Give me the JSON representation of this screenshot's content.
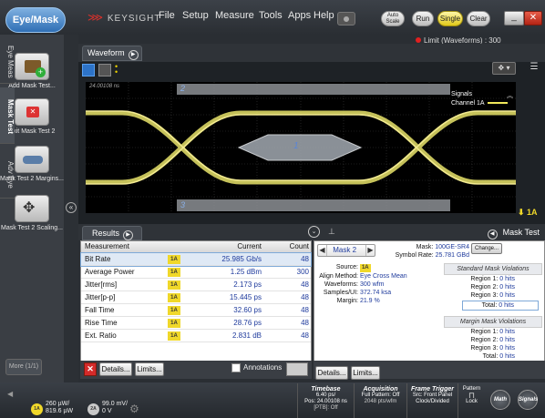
{
  "app": {
    "mode_button": "Eye/Mask",
    "brand": "KEYSIGHT",
    "menu": [
      "File",
      "Setup",
      "Measure",
      "Tools",
      "Apps",
      "Help"
    ],
    "auto_scale": "Auto Scale",
    "run": "Run",
    "single": "Single",
    "clear": "Clear",
    "limit_status": "Limit (Waveforms) : 300"
  },
  "left_panel": {
    "items": [
      {
        "label": "Add Mask Test...",
        "icon": "add-mask-icon"
      },
      {
        "label": "Exit Mask Test 2",
        "icon": "exit-mask-icon"
      },
      {
        "label": "Mask Test 2 Margins...",
        "icon": "margins-icon"
      },
      {
        "label": "Mask Test 2 Scaling...",
        "icon": "scaling-icon"
      }
    ],
    "more": "More (1/1)"
  },
  "vertical_tabs": [
    "Eye Meas",
    "Mask Test",
    "Adv Eye"
  ],
  "waveform": {
    "tab_label": "Waveform",
    "timestamp": "24.00108 ns",
    "region_labels": [
      "1",
      "2",
      "3"
    ],
    "legend_title": "Signals",
    "legend_channel": "Channel 1A",
    "channel_marker": "1A"
  },
  "results": {
    "tab_label": "Results",
    "columns": [
      "Measurement",
      "Current",
      "Count"
    ],
    "rows": [
      {
        "name": "Bit Rate",
        "ch": "1A",
        "current": "25.985 Gb/s",
        "count": "48"
      },
      {
        "name": "Average Power",
        "ch": "1A",
        "current": "1.25 dBm",
        "count": "300"
      },
      {
        "name": "Jitter[rms]",
        "ch": "1A",
        "current": "2.173 ps",
        "count": "48"
      },
      {
        "name": "Jitter[p-p]",
        "ch": "1A",
        "current": "15.445 ps",
        "count": "48"
      },
      {
        "name": "Fall Time",
        "ch": "1A",
        "current": "32.60 ps",
        "count": "48"
      },
      {
        "name": "Rise Time",
        "ch": "1A",
        "current": "28.76 ps",
        "count": "48"
      },
      {
        "name": "Ext. Ratio",
        "ch": "1A",
        "current": "2.831 dB",
        "count": "48"
      }
    ],
    "details": "Details...",
    "limits": "Limits...",
    "annotations": "Annotations"
  },
  "mask_panel": {
    "tab_label": "Mask Test",
    "selector": "Mask 2",
    "mask_label": "Mask:",
    "mask_value": "100GE-SR4",
    "change": "Change...",
    "symbol_rate_label": "Symbol Rate:",
    "symbol_rate": "25.781 GBd",
    "source_label": "Source:",
    "source": "1A",
    "align_label": "Align Method:",
    "align": "Eye Cross Mean",
    "waveforms_label": "Waveforms:",
    "waveforms": "300 wfm",
    "samples_label": "Samples/UI:",
    "samples": "372.74 ksa",
    "margin_label": "Margin:",
    "margin": "21.9 %",
    "standard_title": "Standard Mask Violations",
    "standard": [
      {
        "label": "Region 1:",
        "value": "0 hits"
      },
      {
        "label": "Region 2:",
        "value": "0 hits"
      },
      {
        "label": "Region 3:",
        "value": "0 hits"
      },
      {
        "label": "Total:",
        "value": "0 hits"
      }
    ],
    "margin_title": "Margin Mask Violations",
    "margin_v": [
      {
        "label": "Region 1:",
        "value": "0 hits"
      },
      {
        "label": "Region 2:",
        "value": "0 hits"
      },
      {
        "label": "Region 3:",
        "value": "0 hits"
      },
      {
        "label": "Total:",
        "value": "0 hits"
      }
    ],
    "details": "Details...",
    "limits": "Limits..."
  },
  "bottom": {
    "ch1": {
      "badge": "1A",
      "line1": "260 µW/",
      "line2": "819.6 µW"
    },
    "ch2": {
      "badge": "2A",
      "line1": "99.0 mV/",
      "line2": "0 V"
    },
    "timebase": {
      "title": "Timebase",
      "l1": "6.40 ps/",
      "l2": "Pos: 24.00108 ns",
      "l3": "[PTB]: Off"
    },
    "acquisition": {
      "title": "Acquisition",
      "l1": "Full Pattern: Off",
      "l2": "2048 pts/wfm"
    },
    "frame_trigger": {
      "title": "Frame Trigger",
      "l1": "Src: Front Panel",
      "l2": "Clock/Divided"
    },
    "pattern": {
      "title": "Pattern",
      "l1": "Lock"
    },
    "math": "Math",
    "signals": "Signals"
  }
}
